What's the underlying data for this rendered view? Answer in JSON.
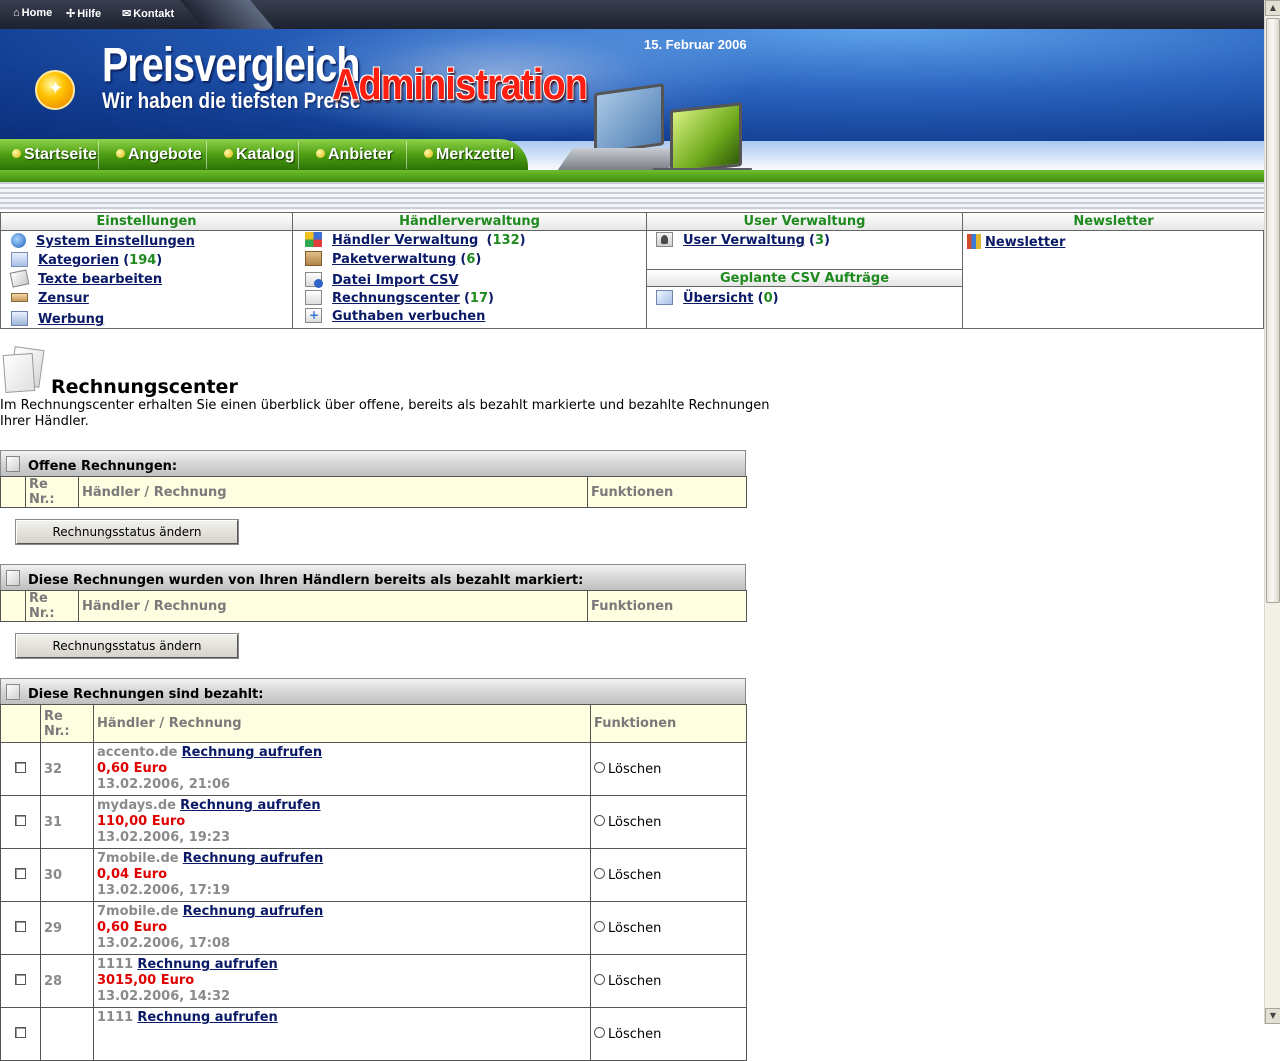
{
  "topbar": {
    "home": "Home",
    "help": "Hilfe",
    "contact": "Kontakt"
  },
  "header": {
    "title": "Preisvergleich",
    "slogan": "Wir haben die tiefsten Preise",
    "admin": "Administration",
    "date": "15. Februar 2006"
  },
  "nav": {
    "items": [
      "Startseite",
      "Angebote",
      "Katalog",
      "Anbieter",
      "Merkzettel"
    ]
  },
  "menu": {
    "einstellungen": {
      "header": "Einstellungen",
      "items": [
        {
          "label": "System Einstellungen",
          "count": ""
        },
        {
          "label": "Kategorien",
          "count": "194"
        },
        {
          "label": "Texte bearbeiten",
          "count": ""
        },
        {
          "label": "Zensur",
          "count": ""
        },
        {
          "label": "Werbung",
          "count": ""
        }
      ]
    },
    "haendler": {
      "header": "Händlerverwaltung",
      "items": [
        {
          "label": "Händler Verwaltung",
          "count": "132"
        },
        {
          "label": "Paketverwaltung",
          "count": "6"
        },
        {
          "label": "Datei Import CSV",
          "count": ""
        },
        {
          "label": "Rechnungscenter",
          "count": "17"
        },
        {
          "label": "Guthaben verbuchen",
          "count": ""
        }
      ]
    },
    "user": {
      "header": "User Verwaltung",
      "items": [
        {
          "label": "User Verwaltung",
          "count": "3"
        }
      ]
    },
    "csv": {
      "header": "Geplante CSV Aufträge",
      "items": [
        {
          "label": "Übersicht",
          "count": "0"
        }
      ]
    },
    "newsletter": {
      "header": "Newsletter",
      "items": [
        {
          "label": "Newsletter"
        }
      ]
    }
  },
  "content": {
    "title": "Rechnungscenter",
    "description": "Im Rechnungscenter erhalten Sie einen überblick über offene, bereits als bezahlt markierte und bezahlte Rechnungen Ihrer Händler.",
    "columns": {
      "renr": "Re Nr.:",
      "haendler": "Händler / Rechnung",
      "funktionen": "Funktionen"
    },
    "button_label": "Rechnungsstatus ändern",
    "sections": {
      "open": "Offene Rechnungen:",
      "marked": "Diese Rechnungen wurden von Ihren Händlern bereits als bezahlt markiert:",
      "paid": "Diese Rechnungen sind bezahlt:"
    },
    "paid_columns": {
      "renr_line1": "Re",
      "renr_line2": "Nr.:"
    },
    "invoice_link": "Rechnung aufrufen",
    "delete_label": "Löschen",
    "paid_rows": [
      {
        "nr": "32",
        "shop": "accento.de",
        "amount": "0,60 Euro",
        "date": "13.02.2006, 21:06"
      },
      {
        "nr": "31",
        "shop": "mydays.de",
        "amount": "110,00 Euro",
        "date": "13.02.2006, 19:23"
      },
      {
        "nr": "30",
        "shop": "7mobile.de",
        "amount": "0,04 Euro",
        "date": "13.02.2006, 17:19"
      },
      {
        "nr": "29",
        "shop": "7mobile.de",
        "amount": "0,60 Euro",
        "date": "13.02.2006, 17:08"
      },
      {
        "nr": "28",
        "shop": "1111",
        "amount": "3015,00 Euro",
        "date": "13.02.2006, 14:32"
      },
      {
        "nr": "",
        "shop": "1111",
        "amount": "",
        "date": ""
      }
    ]
  }
}
